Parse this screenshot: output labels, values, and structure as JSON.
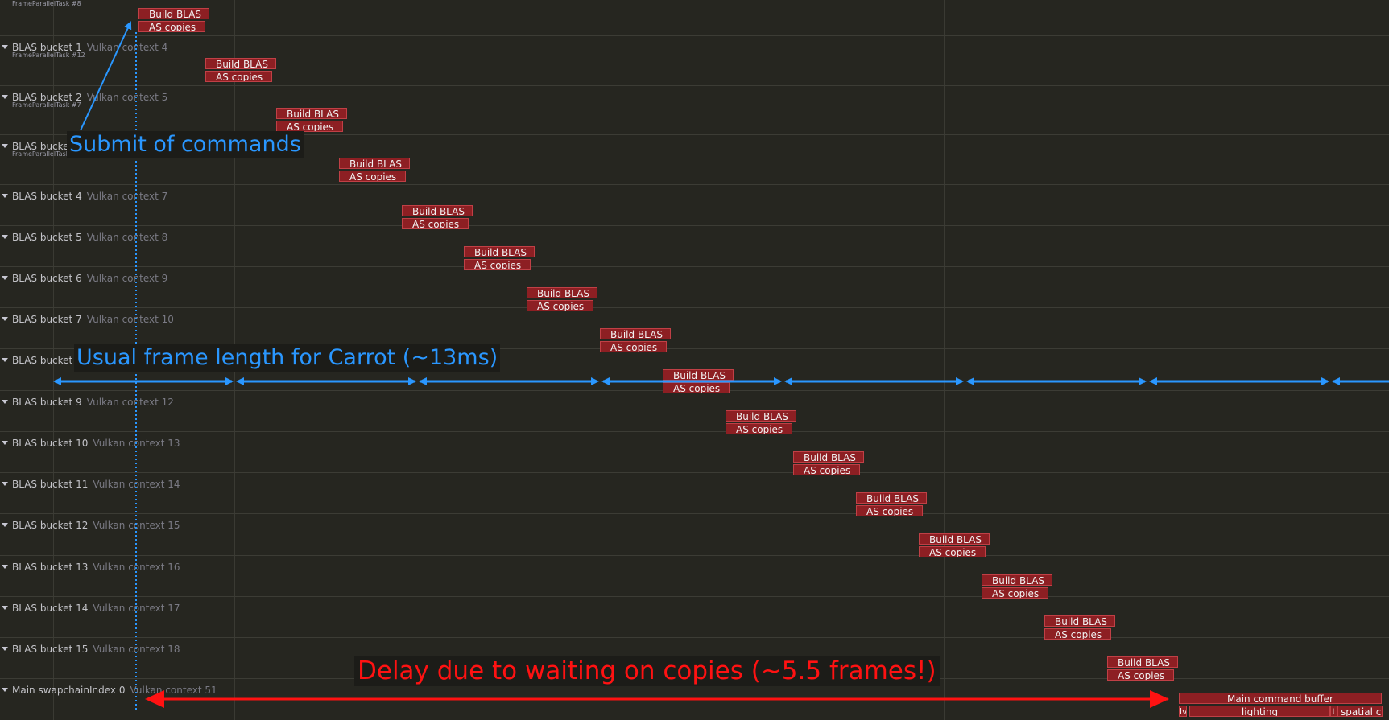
{
  "header": {
    "top_subtask": "FrameParallelTask #8"
  },
  "lanes": [
    {
      "name": "BLAS bucket 1",
      "context": "Vulkan context 4",
      "subtask": "FrameParallelTask #12"
    },
    {
      "name": "BLAS bucket 2",
      "context": "Vulkan context 5",
      "subtask": "FrameParallelTask #7"
    },
    {
      "name": "BLAS bucket 3",
      "context": "",
      "subtask": "FrameParallelTask #"
    },
    {
      "name": "BLAS bucket 4",
      "context": "Vulkan context 7",
      "subtask": ""
    },
    {
      "name": "BLAS bucket 5",
      "context": "Vulkan context 8",
      "subtask": ""
    },
    {
      "name": "BLAS bucket 6",
      "context": "Vulkan context 9",
      "subtask": ""
    },
    {
      "name": "BLAS bucket 7",
      "context": "Vulkan context 10",
      "subtask": ""
    },
    {
      "name": "BLAS bucket 8",
      "context": "",
      "subtask": ""
    },
    {
      "name": "BLAS bucket 9",
      "context": "Vulkan context 12",
      "subtask": ""
    },
    {
      "name": "BLAS bucket 10",
      "context": "Vulkan context 13",
      "subtask": ""
    },
    {
      "name": "BLAS bucket 11",
      "context": "Vulkan context 14",
      "subtask": ""
    },
    {
      "name": "BLAS bucket 12",
      "context": "Vulkan context 15",
      "subtask": ""
    },
    {
      "name": "BLAS bucket 13",
      "context": "Vulkan context 16",
      "subtask": ""
    },
    {
      "name": "BLAS bucket 14",
      "context": "Vulkan context 17",
      "subtask": ""
    },
    {
      "name": "BLAS bucket 15",
      "context": "Vulkan context 18",
      "subtask": ""
    },
    {
      "name": "Main swapchainIndex 0",
      "context": "Vulkan context 51",
      "subtask": ""
    }
  ],
  "task_labels": {
    "build": "Build BLAS",
    "copies": "AS copies"
  },
  "main_blocks": {
    "top": "Main command buffer",
    "bottom_left": "lv",
    "bottom_mid": "lighting",
    "bottom_small": "t",
    "bottom_right": "spatial c"
  },
  "annotations": {
    "submit": "Submit of commands",
    "frame_length": "Usual frame length for Carrot (~13ms)",
    "delay": "Delay due to waiting on copies (~5.5 frames!)"
  },
  "colors": {
    "background": "#262620",
    "task_block": "#8d1f23",
    "annotation_blue": "#2a97ff",
    "annotation_red": "#ff1212"
  }
}
